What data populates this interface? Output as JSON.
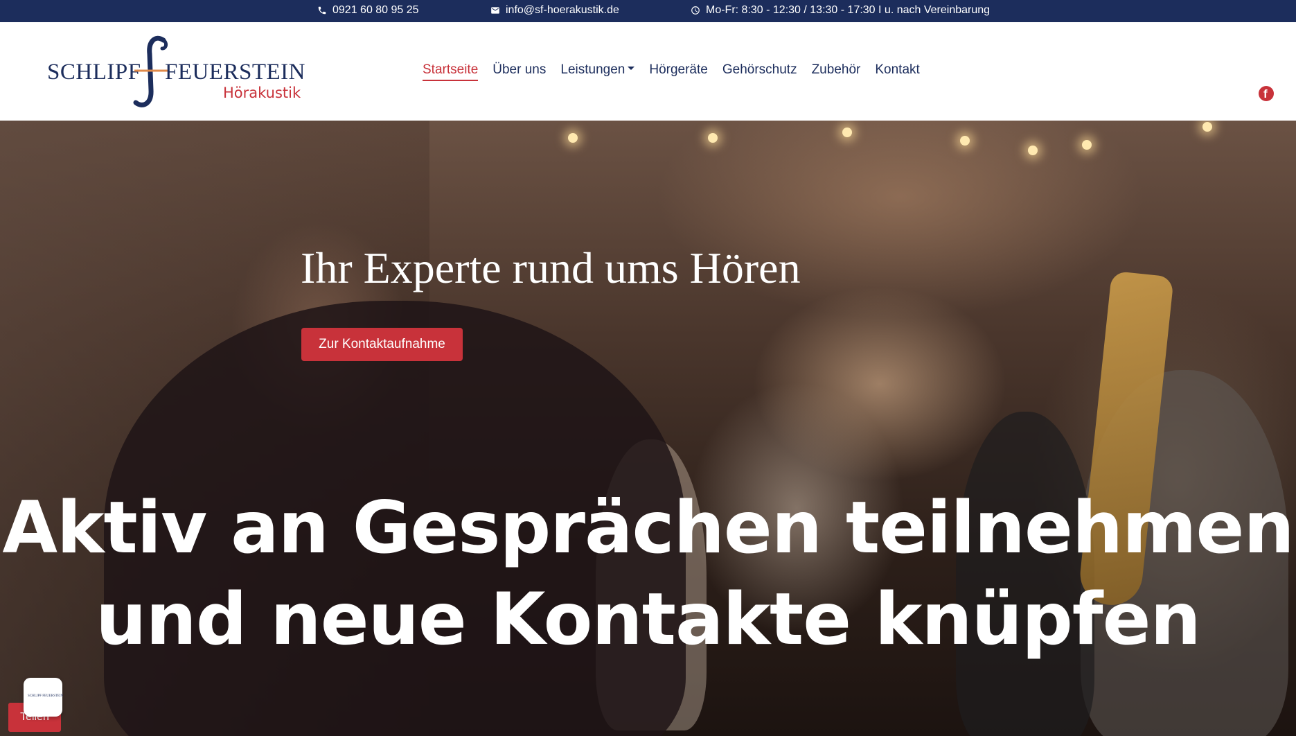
{
  "topbar": {
    "phone": "0921 60 80 95 25",
    "email": "info@sf-hoerakustik.de",
    "hours": "Mo-Fr: 8:30 - 12:30 / 13:30 - 17:30 I u. nach Vereinbarung"
  },
  "logo": {
    "brand_left": "SCHLIPF",
    "brand_right": "FEUERSTEIN",
    "sub": "Hörakustik"
  },
  "nav": {
    "items": [
      {
        "label": "Startseite"
      },
      {
        "label": "Über uns"
      },
      {
        "label": "Leistungen"
      },
      {
        "label": "Hörgeräte"
      },
      {
        "label": "Gehörschutz"
      },
      {
        "label": "Zubehör"
      },
      {
        "label": "Kontakt"
      }
    ],
    "social_icon": "facebook-icon"
  },
  "hero": {
    "headline": "Ihr Experte rund ums Hören",
    "cta_label": "Zur Kontaktaufnahme",
    "video_line1": "Aktiv an Gesprächen teilnehmen",
    "video_line2": "und neue Kontakte knüpfen"
  },
  "share": {
    "label": "Teilen",
    "logo_text": "SCHLIPF FEUERSTEIN"
  },
  "colors": {
    "brand_navy": "#1c2d5c",
    "brand_red": "#c8323a"
  }
}
